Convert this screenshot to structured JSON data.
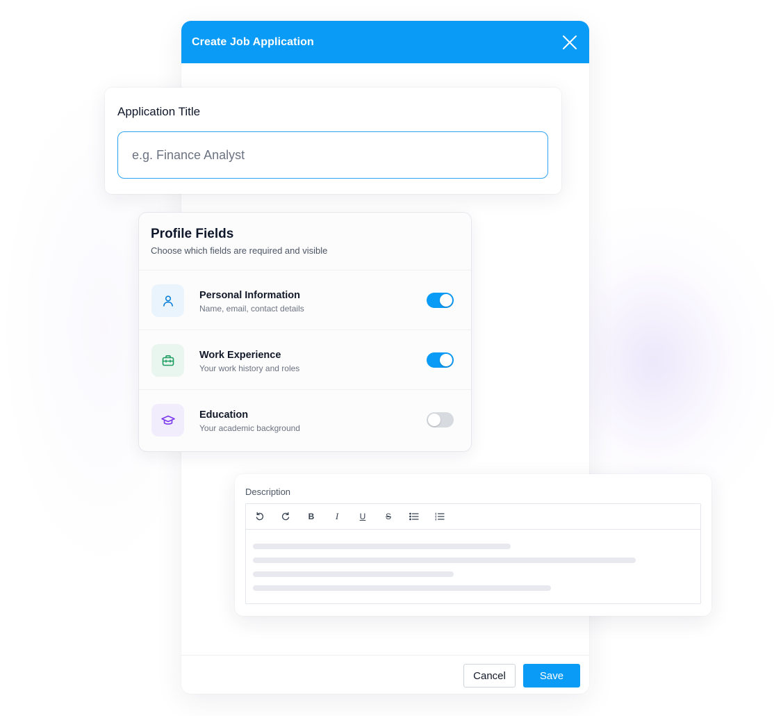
{
  "modal": {
    "title": "Create Job Application",
    "cancel_label": "Cancel",
    "save_label": "Save"
  },
  "application_title": {
    "label": "Application Title",
    "placeholder": "e.g. Finance Analyst",
    "value": ""
  },
  "profile_fields": {
    "title": "Profile Fields",
    "subtitle": "Choose which fields are required and visible",
    "items": [
      {
        "title": "Personal Information",
        "subtitle": "Name, email, contact details",
        "icon": "user-icon",
        "enabled": true,
        "icon_color": "#0a7fd8",
        "icon_bg": "#eaf4fd"
      },
      {
        "title": "Work Experience",
        "subtitle": "Your work history and roles",
        "icon": "briefcase-icon",
        "enabled": true,
        "icon_color": "#1f9d63",
        "icon_bg": "#e8f6ef"
      },
      {
        "title": "Education",
        "subtitle": "Your academic background",
        "icon": "graduation-cap-icon",
        "enabled": false,
        "icon_color": "#7c3aed",
        "icon_bg": "#f1edfc"
      }
    ]
  },
  "description": {
    "label": "Description",
    "toolbar": [
      "undo-icon",
      "redo-icon",
      "bold-icon",
      "italic-icon",
      "underline-icon",
      "strikethrough-icon",
      "bullet-list-icon",
      "numbered-list-icon"
    ],
    "toolbar_glyphs": {
      "bold": "B",
      "italic": "I",
      "underline": "U",
      "strike": "S"
    }
  },
  "colors": {
    "accent": "#0a9bf6",
    "toggle_off": "#d7dadf"
  }
}
